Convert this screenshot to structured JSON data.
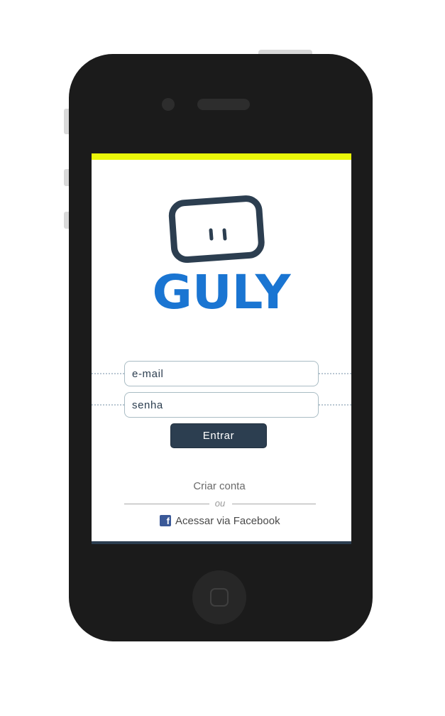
{
  "brand": {
    "name": "GULY",
    "logo_color": "#1a75d2",
    "mascot_color": "#2c3e50",
    "accent_color": "#eaf70a"
  },
  "login_form": {
    "email_placeholder": "e-mail",
    "password_placeholder": "senha",
    "submit_label": "Entrar"
  },
  "footer": {
    "create_account_label": "Criar conta",
    "or_label": "ou",
    "facebook_label": "Acessar via Facebook",
    "facebook_icon": "facebook-icon",
    "facebook_color": "#3b5998"
  }
}
